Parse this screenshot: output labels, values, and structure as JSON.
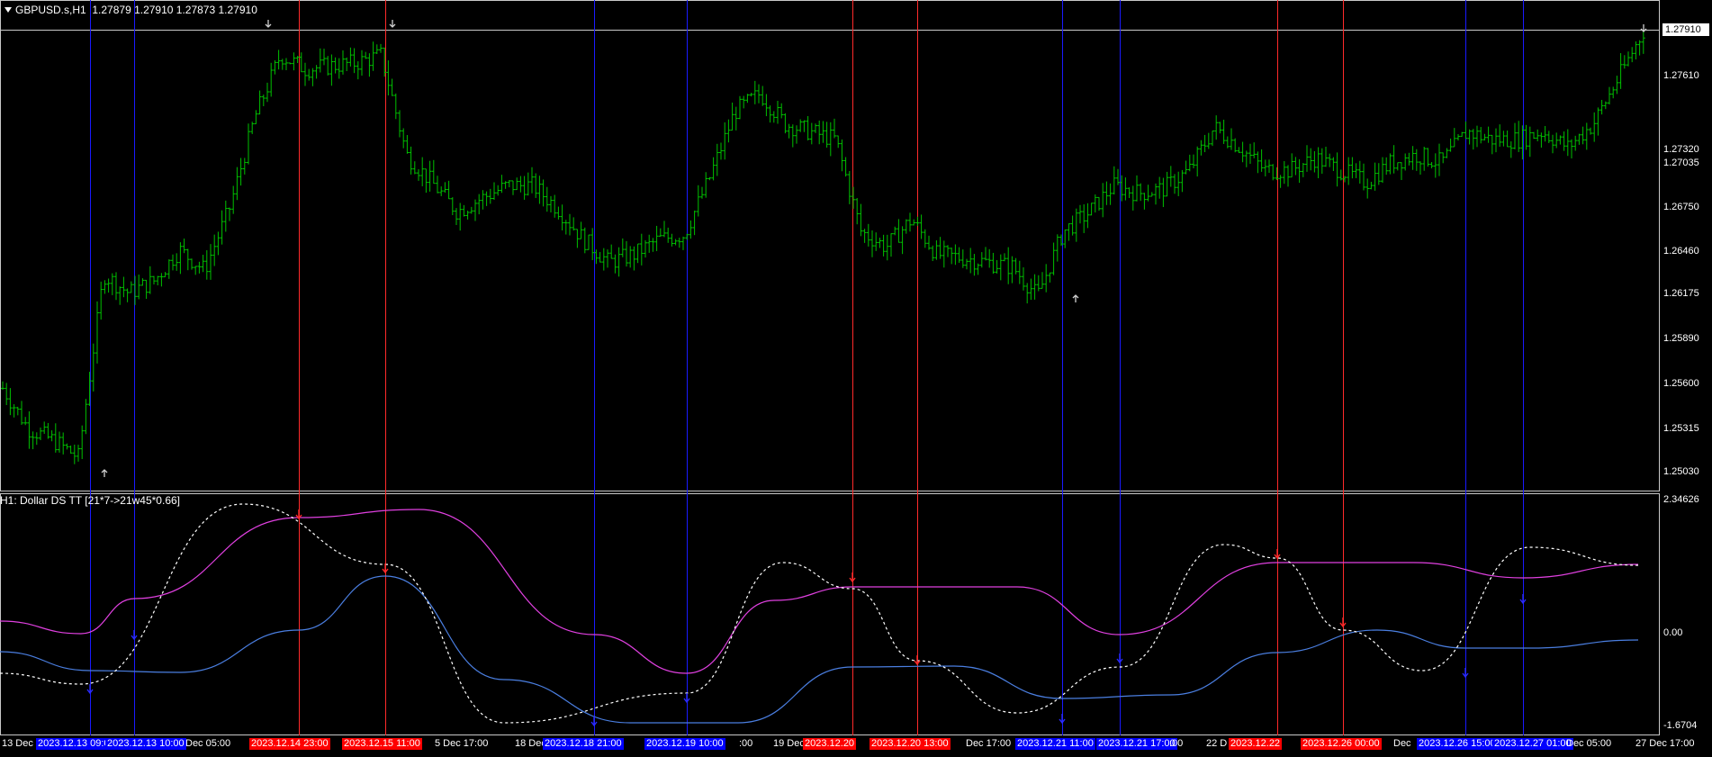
{
  "main_title": {
    "symbol": "GBPUSD.s,H1",
    "ohlc": "1.27879 1.27910 1.27873 1.27910"
  },
  "current_price": "1.27910",
  "price_axis": [
    "1.27610",
    "1.27320",
    "1.27035",
    "1.26750",
    "1.26460",
    "1.26175",
    "1.25890",
    "1.25600",
    "1.25315",
    "1.25030"
  ],
  "indicator_title": "H1: Dollar DS TT [21*7->21w45*0.66]",
  "indicator_axis": [
    "2.34626",
    "0.00",
    "-1.6704"
  ],
  "time_axis": [
    {
      "text": "13 Dec 2",
      "bg": ""
    },
    {
      "text": "2023.12.13 09:00",
      "bg": "#0000ff"
    },
    {
      "text": "2023.12.13 10:00",
      "bg": "#0000ff"
    },
    {
      "text": "Dec 05:00",
      "bg": ""
    },
    {
      "text": "2023.12.14 23:00",
      "bg": "#ff0000"
    },
    {
      "text": "2023.12.15 11:00",
      "bg": "#ff0000"
    },
    {
      "text": "5 Dec 17:00",
      "bg": ""
    },
    {
      "text": "18 Dec",
      "bg": ""
    },
    {
      "text": "2023.12.18 21:00",
      "bg": "#0000ff"
    },
    {
      "text": "2023.12.19 10:00",
      "bg": "#0000ff"
    },
    {
      "text": ":00",
      "bg": ""
    },
    {
      "text": "19 Dec",
      "bg": ""
    },
    {
      "text": "2023.12.20",
      "bg": "#ff0000"
    },
    {
      "text": "2023.12.20 13:00",
      "bg": "#ff0000"
    },
    {
      "text": "Dec 17:00",
      "bg": ""
    },
    {
      "text": "2023.12.21 11:00",
      "bg": "#0000ff"
    },
    {
      "text": "2023.12.21 17:00",
      "bg": "#0000ff"
    },
    {
      "text": ":00",
      "bg": ""
    },
    {
      "text": "22 D",
      "bg": ""
    },
    {
      "text": "2023.12.22",
      "bg": "#ff0000"
    },
    {
      "text": "2023.12.26 00:00",
      "bg": "#ff0000"
    },
    {
      "text": "Dec",
      "bg": ""
    },
    {
      "text": "2023.12.26 15:00",
      "bg": "#0000ff"
    },
    {
      "text": "2023.12.27 01:00",
      "bg": "#0000ff"
    },
    {
      "text": "Dec 05:00",
      "bg": ""
    },
    {
      "text": "27 Dec 17:00",
      "bg": ""
    }
  ],
  "colors": {
    "background": "#000000",
    "bars": "#00c000",
    "red_line": "#ff2a2a",
    "blue_line": "#1a1aff",
    "magenta_curve": "#e040e0",
    "blue_curve": "#4a7ee0",
    "dotted_curve": "#ffffff"
  },
  "chart_data": {
    "type": "line",
    "series": [
      {
        "name": "",
        "values": [
          1.2558,
          1.2532,
          1.2524,
          1.2513,
          1.2632,
          1.262,
          1.2628,
          1.2648,
          1.2635,
          1.2676,
          1.2735,
          1.2775,
          1.2766,
          1.2768,
          1.277,
          1.2775,
          1.271,
          1.2692,
          1.2673,
          1.2682,
          1.269,
          1.269,
          1.2675,
          1.2655,
          1.264,
          1.2645,
          1.2655,
          1.2658,
          1.2695,
          1.2738,
          1.275,
          1.273,
          1.2725,
          1.272,
          1.266,
          1.265,
          1.2668,
          1.2645,
          1.2643,
          1.264,
          1.2637,
          1.2618,
          1.266,
          1.2672,
          1.269,
          1.2685,
          1.2688,
          1.27,
          1.2728,
          1.2715,
          1.27,
          1.27,
          1.2708,
          1.27,
          1.2692,
          1.2705,
          1.271,
          1.2705,
          1.2725,
          1.272,
          1.272,
          1.2725,
          1.2715,
          1.273,
          1.276,
          1.2791
        ]
      }
    ],
    "y_range": [
      1.249,
      1.28
    ]
  }
}
